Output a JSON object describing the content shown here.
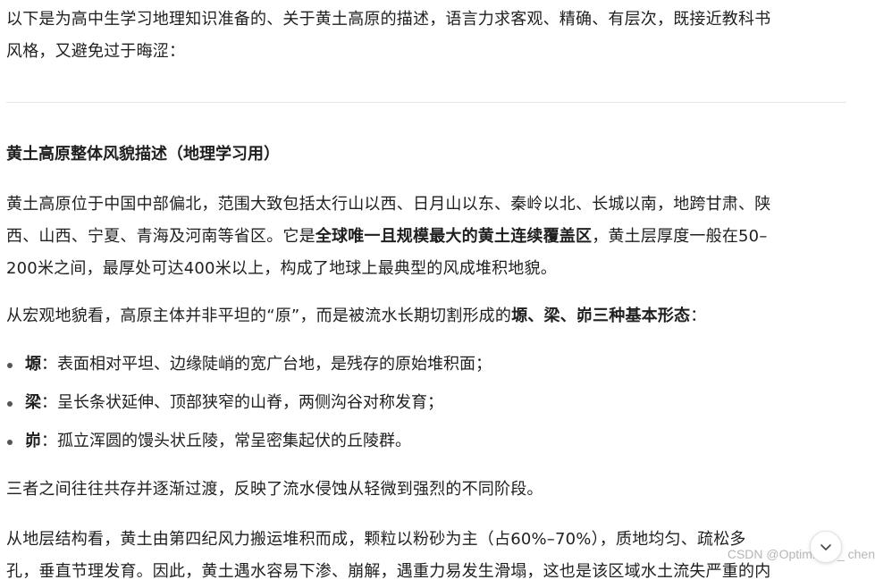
{
  "intro": {
    "line1": "以下是为高中生学习地理知识准备的、关于黄土高原的描述，语言力求客观、精确、有层次，既接近教科书",
    "line2": "风格，又避免过于晦涩："
  },
  "heading": "黄土高原整体风貌描述（地理学习用）",
  "para1": {
    "line1": "黄土高原位于中国中部偏北，范围大致包括太行山以西、日月山以东、秦岭以北、长城以南，地跨甘肃、陕",
    "line2_a": "西、山西、宁夏、青海及河南等省区。它是",
    "line2_bold": "全球唯一且规模最大的黄土连续覆盖区",
    "line2_b": "，黄土层厚度一般在50–",
    "line3": "200米之间，最厚处可达400米以上，构成了地球上最典型的风成堆积地貌。"
  },
  "para2": {
    "text_a": "从宏观地貌看，高原主体并非平坦的“原”，而是被流水长期切割形成的",
    "text_bold": "塬、梁、峁三种基本形态",
    "text_b": "："
  },
  "landforms": [
    {
      "term": "塬",
      "desc": "：表面相对平坦、边缘陡峭的宽广台地，是残存的原始堆积面；"
    },
    {
      "term": "梁",
      "desc": "：呈长条状延伸、顶部狭窄的山脊，两侧沟谷对称发育；"
    },
    {
      "term": "峁",
      "desc": "：孤立浑圆的馒头状丘陵，常呈密集起伏的丘陵群。"
    }
  ],
  "para3": "三者之间往往共存并逐渐过渡，反映了流水侵蚀从轻微到强烈的不同阶段。",
  "para4": {
    "line1": "从地层结构看，黄土由第四纪风力搬运堆积而成，颗粒以粉砂为主（占60%–70%），质地均匀、疏松多",
    "line2": "孔，垂直节理发育。因此，黄土遇水容易下渗、崩解，遇重力易发生滑塌，这也是该区域水土流失严重的内"
  },
  "watermark": "CSDN @Optimistic _ chen",
  "scroll_icon": "chevron-down-icon"
}
